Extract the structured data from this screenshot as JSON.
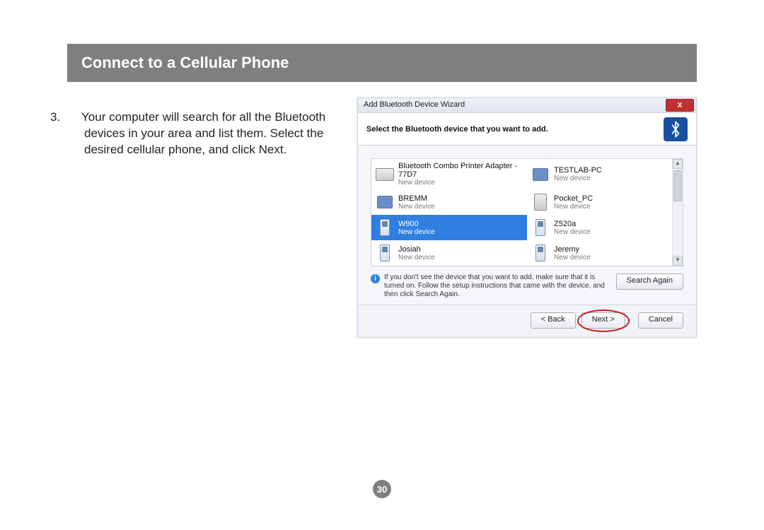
{
  "title": "Connect to a Cellular Phone",
  "step": {
    "number": "3.",
    "text": "Your computer will search for all the Bluetooth devices in your area and list them. Select the desired cellular phone, and click Next."
  },
  "wizard": {
    "window_title": "Add Bluetooth Device Wizard",
    "close_label": "X",
    "headline": "Select the Bluetooth device that you want to add.",
    "devices": [
      {
        "name": "Bluetooth Combo Printer Adapter - 77D7",
        "sub": "New device",
        "icon": "printer",
        "selected": false
      },
      {
        "name": "TESTLAB-PC",
        "sub": "New device",
        "icon": "pc",
        "selected": false
      },
      {
        "name": "BREMM",
        "sub": "New device",
        "icon": "pc",
        "selected": false
      },
      {
        "name": "Pocket_PC",
        "sub": "New device",
        "icon": "pda",
        "selected": false
      },
      {
        "name": "W900",
        "sub": "New device",
        "icon": "phone",
        "selected": true
      },
      {
        "name": "Z520a",
        "sub": "New device",
        "icon": "phone",
        "selected": false
      },
      {
        "name": "Josiah",
        "sub": "New device",
        "icon": "phone",
        "selected": false
      },
      {
        "name": "Jeremy",
        "sub": "New device",
        "icon": "phone",
        "selected": false
      }
    ],
    "hint": "If you don't see the device that you want to add, make sure that it is turned on. Follow the setup instructions that came with the device, and then click Search Again.",
    "buttons": {
      "search_again": "Search Again",
      "back": "< Back",
      "next": "Next >",
      "cancel": "Cancel"
    },
    "highlighted_button": "next"
  },
  "page_number": "30"
}
